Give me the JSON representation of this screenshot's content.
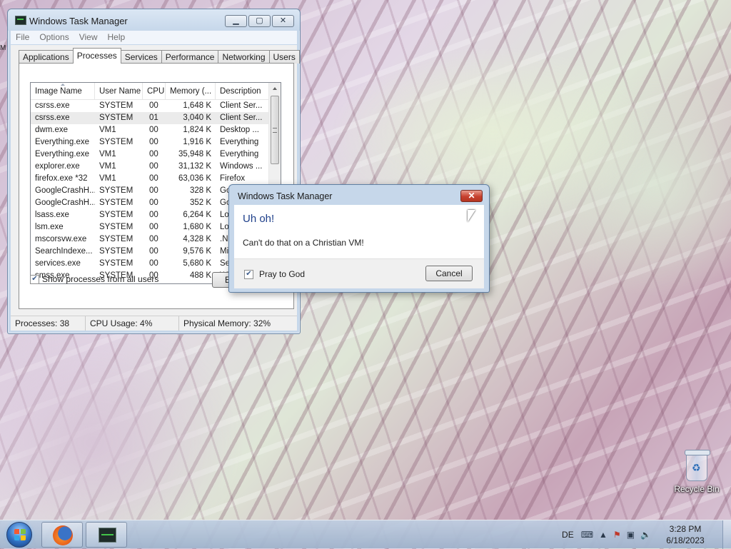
{
  "task_manager": {
    "title": "Windows Task Manager",
    "menu": [
      "File",
      "Options",
      "View",
      "Help"
    ],
    "tabs": [
      "Applications",
      "Processes",
      "Services",
      "Performance",
      "Networking",
      "Users"
    ],
    "active_tab": "Processes",
    "columns": {
      "image_name": "Image Name",
      "user_name": "User Name",
      "cpu": "CPU",
      "memory": "Memory (...",
      "description": "Description"
    },
    "processes": [
      {
        "name": "csrss.exe",
        "user": "SYSTEM",
        "cpu": "00",
        "memory": "1,648 K",
        "description": "Client Ser..."
      },
      {
        "name": "csrss.exe",
        "user": "SYSTEM",
        "cpu": "01",
        "memory": "3,040 K",
        "description": "Client Ser..."
      },
      {
        "name": "dwm.exe",
        "user": "VM1",
        "cpu": "00",
        "memory": "1,824 K",
        "description": "Desktop ..."
      },
      {
        "name": "Everything.exe",
        "user": "SYSTEM",
        "cpu": "00",
        "memory": "1,916 K",
        "description": "Everything"
      },
      {
        "name": "Everything.exe",
        "user": "VM1",
        "cpu": "00",
        "memory": "35,948 K",
        "description": "Everything"
      },
      {
        "name": "explorer.exe",
        "user": "VM1",
        "cpu": "00",
        "memory": "31,132 K",
        "description": "Windows ..."
      },
      {
        "name": "firefox.exe *32",
        "user": "VM1",
        "cpu": "00",
        "memory": "63,036 K",
        "description": "Firefox"
      },
      {
        "name": "GoogleCrashH...",
        "user": "SYSTEM",
        "cpu": "00",
        "memory": "328 K",
        "description": "Google Cr"
      },
      {
        "name": "GoogleCrashH...",
        "user": "SYSTEM",
        "cpu": "00",
        "memory": "352 K",
        "description": "Goo"
      },
      {
        "name": "lsass.exe",
        "user": "SYSTEM",
        "cpu": "00",
        "memory": "6,264 K",
        "description": "Loc"
      },
      {
        "name": "lsm.exe",
        "user": "SYSTEM",
        "cpu": "00",
        "memory": "1,680 K",
        "description": "Loc"
      },
      {
        "name": "mscorsvw.exe",
        "user": "SYSTEM",
        "cpu": "00",
        "memory": "4,328 K",
        "description": ".NE"
      },
      {
        "name": "SearchIndexe...",
        "user": "SYSTEM",
        "cpu": "00",
        "memory": "9,576 K",
        "description": "Mic"
      },
      {
        "name": "services.exe",
        "user": "SYSTEM",
        "cpu": "00",
        "memory": "5,680 K",
        "description": "Ser"
      },
      {
        "name": "smss.exe",
        "user": "SYSTEM",
        "cpu": "00",
        "memory": "488 K",
        "description": "Win"
      }
    ],
    "selected_row": 1,
    "show_all_label": "Show processes from all users",
    "show_all_checked": true,
    "end_process_label": "E",
    "status": {
      "processes": "Processes: 38",
      "cpu_usage": "CPU Usage: 4%",
      "physical_memory": "Physical Memory: 32%"
    }
  },
  "dialog": {
    "title": "Windows Task Manager",
    "heading": "Uh oh!",
    "message": "Can't do that on a Christian VM!",
    "checkbox_label": "Pray to God",
    "checkbox_checked": true,
    "cancel_label": "Cancel"
  },
  "desktop": {
    "side_label": "M",
    "recycle_bin_label": "Recycle Bin"
  },
  "taskbar": {
    "language": "DE",
    "time": "3:28 PM",
    "date": "6/18/2023"
  },
  "icons": {
    "app": "task-manager-icon",
    "close": "close-icon",
    "firefox": "firefox-icon",
    "recycle": "recycle-bin-icon"
  },
  "colors": {
    "dialog_heading": "#1e3f8a",
    "close_button": "#c7412f"
  }
}
